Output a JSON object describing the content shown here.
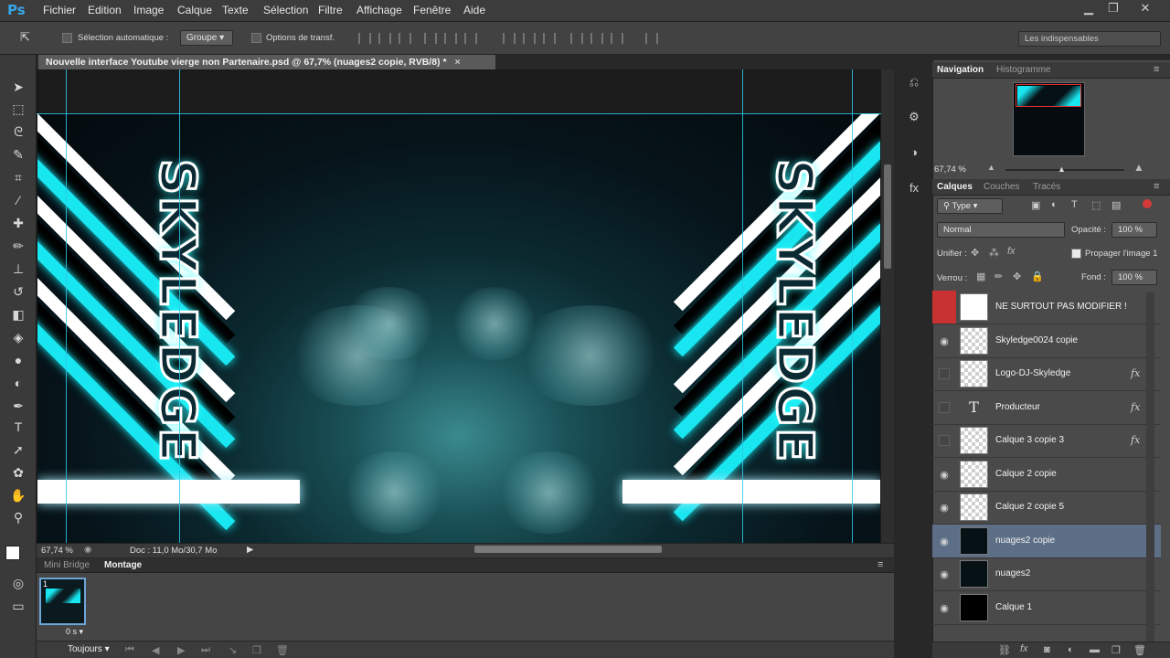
{
  "app": {
    "logo": "Ps"
  },
  "menu": [
    "Fichier",
    "Edition",
    "Image",
    "Calque",
    "Texte",
    "Sélection",
    "Filtre",
    "Affichage",
    "Fenêtre",
    "Aide"
  ],
  "window_controls": {
    "minimize": "▁",
    "restore": "❐",
    "close": "✕"
  },
  "options_bar": {
    "auto_select_label": "Sélection automatique :",
    "auto_select_target": "Groupe",
    "transform_options_label": "Options de transf.",
    "workspace": "Les indispensables"
  },
  "document": {
    "tab_title": "Nouvelle interface Youtube vierge non Partenaire.psd @ 67,7% (nuages2 copie, RVB/8) *",
    "close": "×",
    "zoom": "67,74 %",
    "doc_info": "Doc : 11,0 Mo/30,7 Mo"
  },
  "artwork": {
    "logo_text": "SKYLEDGE",
    "colors": {
      "cyan": "#18e6f0",
      "white": "#ffffff",
      "black": "#000000"
    }
  },
  "bottom_panel": {
    "tabs": [
      "Mini Bridge",
      "Montage"
    ],
    "active_tab": "Montage",
    "frame_number": "1",
    "frame_delay": "0 s",
    "loop": "Toujours"
  },
  "navigation": {
    "tabs": [
      "Navigation",
      "Histogramme"
    ],
    "zoom": "67,74 %"
  },
  "layers_panel": {
    "tabs": [
      "Calques",
      "Couches",
      "Tracés"
    ],
    "filter": "Type",
    "blend_mode": "Normal",
    "opacity_label": "Opacité :",
    "opacity": "100 %",
    "unify_label": "Unifier :",
    "propagate_label": "Propager l'image 1",
    "lock_label": "Verrou :",
    "fill_label": "Fond :",
    "fill": "100 %",
    "layers": [
      {
        "name": "NE SURTOUT PAS MODIFIER !",
        "visible": "locked",
        "thumb": "white",
        "fx": false
      },
      {
        "name": "Skyledge0024 copie",
        "visible": "on",
        "thumb": "transparent",
        "fx": false
      },
      {
        "name": "Logo-DJ-Skyledge",
        "visible": "off",
        "thumb": "transparent",
        "fx": true
      },
      {
        "name": "Producteur",
        "visible": "off",
        "thumb": "type",
        "fx": true
      },
      {
        "name": "Calque 3 copie 3",
        "visible": "off",
        "thumb": "transparent",
        "fx": true
      },
      {
        "name": "Calque 2 copie",
        "visible": "on",
        "thumb": "transparent",
        "fx": false
      },
      {
        "name": "Calque 2 copie 5",
        "visible": "on",
        "thumb": "transparent",
        "fx": false
      },
      {
        "name": "nuages2 copie",
        "visible": "on",
        "thumb": "dark",
        "fx": false,
        "selected": true
      },
      {
        "name": "nuages2",
        "visible": "on",
        "thumb": "dark",
        "fx": false
      },
      {
        "name": "Calque 1",
        "visible": "on",
        "thumb": "black",
        "fx": false
      }
    ],
    "fx_label": "fx",
    "type_icon": "T"
  }
}
